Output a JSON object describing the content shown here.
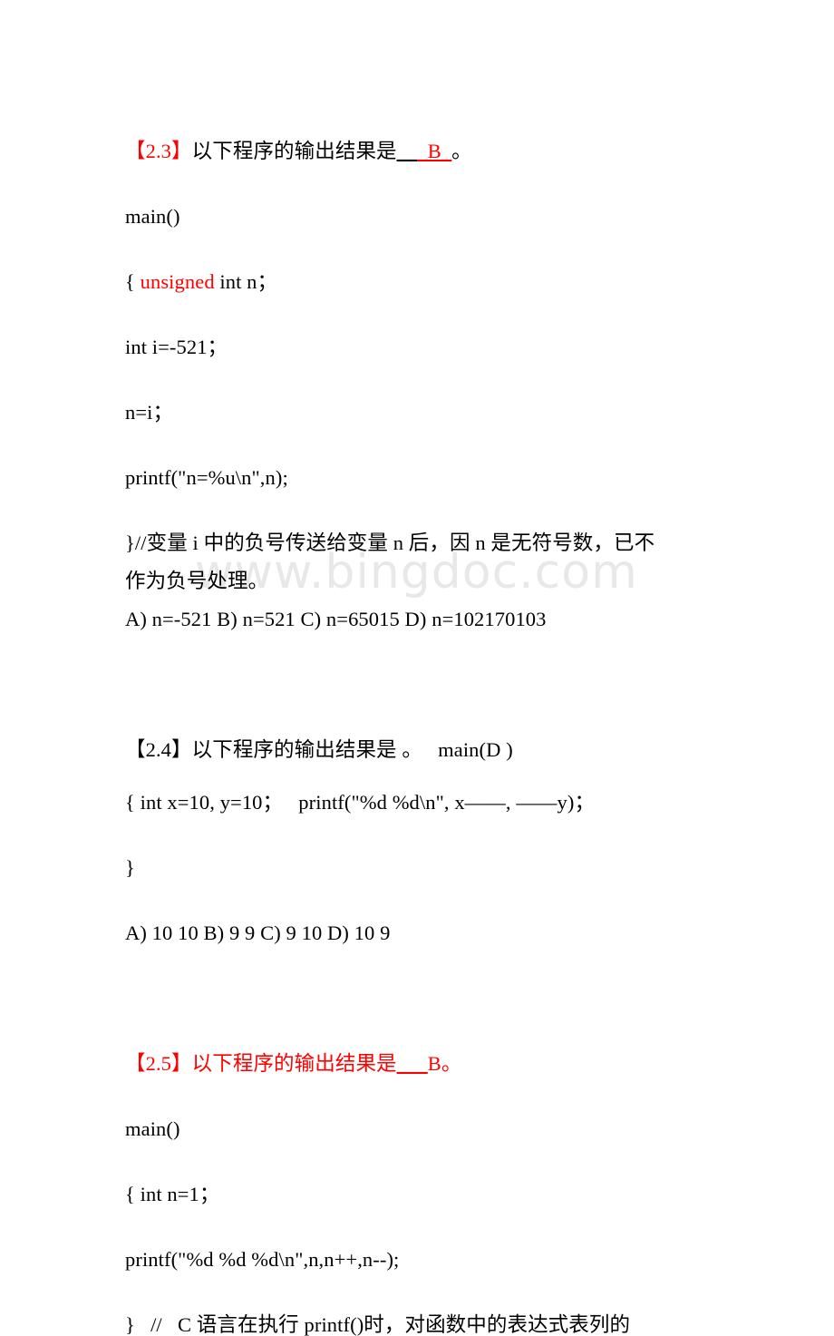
{
  "document": {
    "watermark": "www.bingdoc.com",
    "colors": {
      "page_background": "#ffffff",
      "body_text": "#000000",
      "highlight_red": "#ff0000",
      "watermark_gray": "#e8e8e8"
    }
  },
  "questions": [
    {
      "id": "2.3",
      "number_label": "【2.3】",
      "number_color": "#ff0000",
      "prompt": "以下程序的输出结果是",
      "blank_before": "__",
      "blank_answer": "_B_",
      "answer": "B",
      "prompt_end": "。",
      "code": [
        {
          "text": "main()",
          "color": "#000000"
        },
        {
          "prefix": "{ ",
          "keyword": "unsigned",
          "keyword_color": "#ff0000",
          "suffix": " int n；"
        },
        {
          "text": "int i=-521；",
          "color": "#000000"
        },
        {
          "text": "n=i；",
          "color": "#000000"
        },
        {
          "text": "printf(\"n=%u\\n\",n);",
          "color": "#000000"
        }
      ],
      "comment_line_1": "}//变量 i 中的负号传送给变量 n 后，因 n 是无符号数，已不",
      "comment_line_2": "作为负号处理。",
      "options": "A) n=-521 B) n=521 C) n=65015 D) n=102170103"
    },
    {
      "id": "2.4",
      "number_label": "【2.4】",
      "number_color": "#000000",
      "prompt": "以下程序的输出结果是 。   main(D )",
      "code": [
        {
          "text": "{ int x=10, y=10；   printf(\"%d %d\\n\", x——, ——y)；",
          "color": "#000000"
        },
        {
          "text": "}",
          "color": "#000000"
        }
      ],
      "options": "A) 10 10 B) 9 9 C) 9 10 D) 10 9"
    },
    {
      "id": "2.5",
      "number_label": "【2.5】",
      "number_color": "#ff0000",
      "prompt": "以下程序的输出结果是",
      "blank_before": "___",
      "answer": "B",
      "prompt_end": "。",
      "code": [
        {
          "text": "main()",
          "color": "#000000"
        },
        {
          "text": "{ int n=1；",
          "color": "#000000"
        },
        {
          "text": "printf(\"%d %d %d\\n\",n,n++,n--);",
          "color": "#000000"
        }
      ],
      "comment_line_1": "}   //   C 语言在执行 printf()时，对函数中的表达式表列的"
    }
  ]
}
